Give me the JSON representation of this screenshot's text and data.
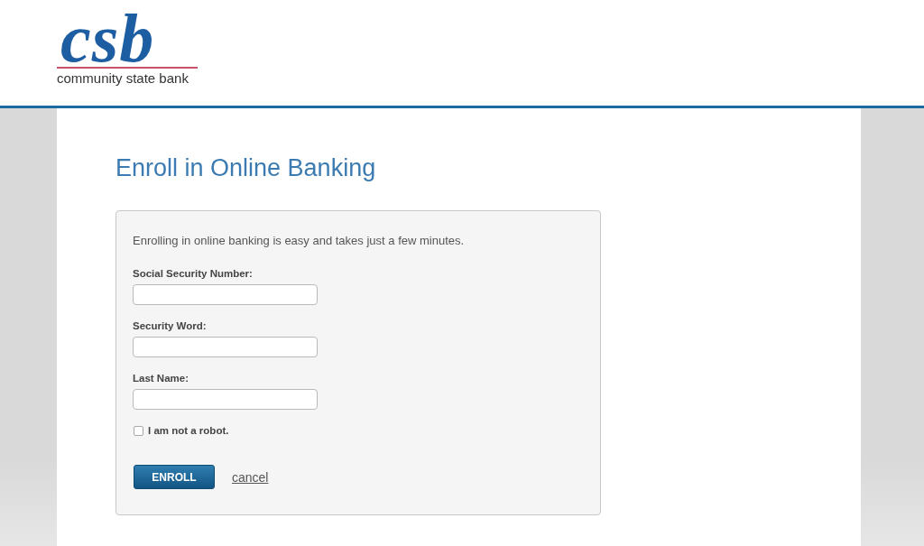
{
  "header": {
    "logo": {
      "mark": "csb",
      "name": "community state bank"
    }
  },
  "page": {
    "title": "Enroll in Online Banking"
  },
  "form": {
    "intro": "Enrolling in online banking is easy and takes just a few minutes.",
    "fields": [
      {
        "label": "Social Security Number:"
      },
      {
        "label": "Security Word:"
      },
      {
        "label": "Last Name:"
      }
    ],
    "robot_check": {
      "label": "I am not a robot.",
      "checked": false
    },
    "actions": [
      {
        "kind": "button",
        "label": "ENROLL"
      },
      {
        "kind": "link",
        "label": "cancel"
      }
    ]
  }
}
